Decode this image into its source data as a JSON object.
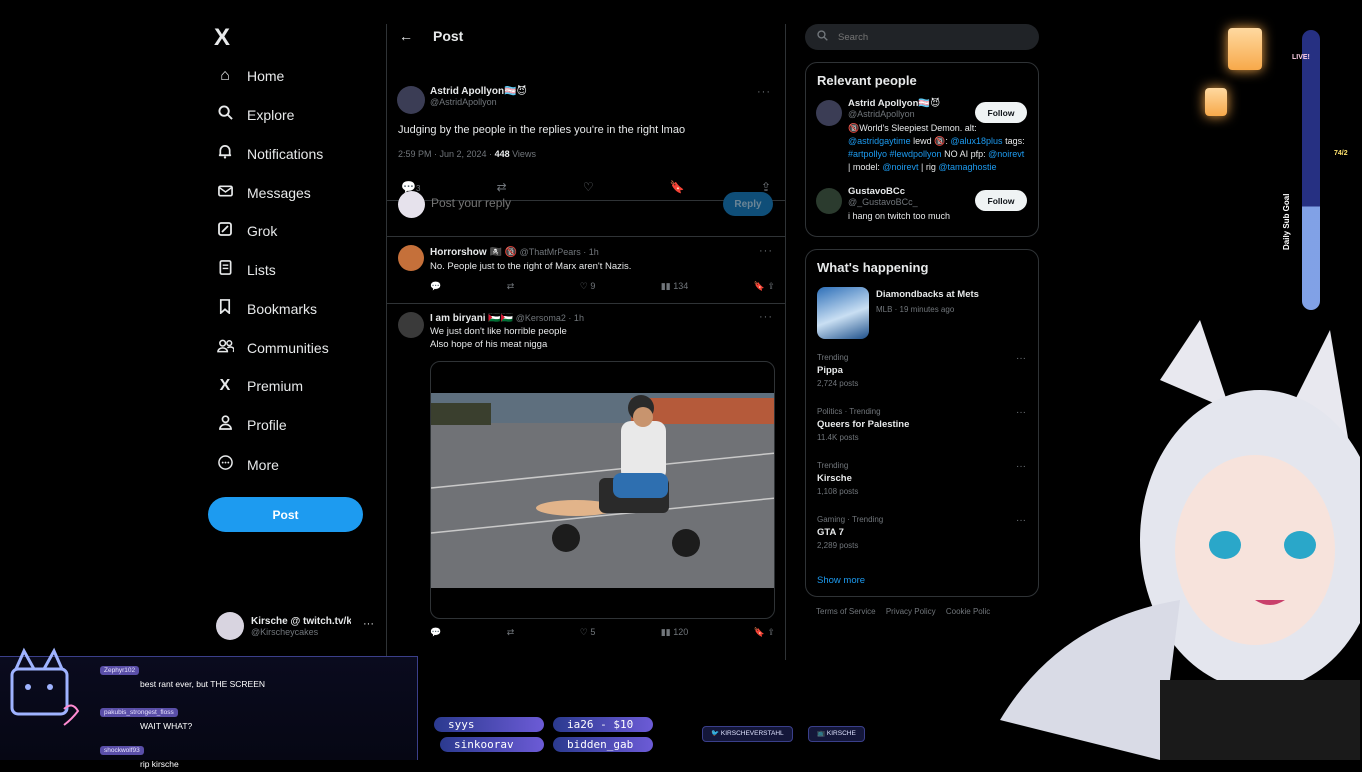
{
  "nav": {
    "logo": "X",
    "items": [
      {
        "label": "Home",
        "icon": "home-icon",
        "glyph": "⌂"
      },
      {
        "label": "Explore",
        "icon": "search-icon",
        "glyph": "⚲"
      },
      {
        "label": "Notifications",
        "icon": "bell-icon",
        "glyph": "🔔"
      },
      {
        "label": "Messages",
        "icon": "envelope-icon",
        "glyph": "✉"
      },
      {
        "label": "Grok",
        "icon": "grok-icon",
        "glyph": "◩"
      },
      {
        "label": "Lists",
        "icon": "list-icon",
        "glyph": "☰"
      },
      {
        "label": "Bookmarks",
        "icon": "bookmark-icon",
        "glyph": "🔖"
      },
      {
        "label": "Communities",
        "icon": "people-icon",
        "glyph": "👥"
      },
      {
        "label": "Premium",
        "icon": "x-icon",
        "glyph": "X"
      },
      {
        "label": "Profile",
        "icon": "person-icon",
        "glyph": "👤"
      },
      {
        "label": "More",
        "icon": "more-circle-icon",
        "glyph": "⋯"
      }
    ],
    "post_button": "Post",
    "account": {
      "name": "Kirsche @ twitch.tv/k",
      "handle": "@Kirscheycakes",
      "more": "···"
    }
  },
  "main": {
    "header": {
      "title": "Post",
      "back": "←"
    },
    "tweet": {
      "name": "Astrid Apollyon🏳️‍⚧️😈",
      "handle": "@AstridApollyon",
      "text": "Judging by the people in the replies you're in the right lmao",
      "time": "2:59 PM · Jun 2, 2024 · ",
      "views_count": "448",
      "views_label": " Views",
      "replies": "3"
    },
    "reply_box": {
      "placeholder": "Post your reply",
      "button": "Reply"
    },
    "replies": [
      {
        "name": "Horrorshow 🏴‍☠️ 🔞",
        "handle": "@ThatMrPears · 1h",
        "text": "No. People just to the right of Marx aren't Nazis.",
        "replies": "",
        "retweets": "",
        "likes": "9",
        "views": "134"
      },
      {
        "name": "I am biryani 🇵🇸🇵🇸",
        "handle": "@Kersoma2 · 1h",
        "text_line1": "We just don't like horrible people",
        "text_line2": "Also hope of his meat nigga",
        "replies": "",
        "retweets": "",
        "likes": "5",
        "views": "120"
      }
    ]
  },
  "right": {
    "search_placeholder": "Search",
    "relevant": {
      "title": "Relevant people",
      "people": [
        {
          "name": "Astrid Apollyon🏳️‍⚧️😈",
          "handle": "@AstridApollyon",
          "bio_a": "🔞World's Sleepiest Demon. alt: ",
          "bio_link1": "@astridgaytime",
          "bio_b": " lewd 🔞: ",
          "bio_link2": "@alux18plus",
          "bio_c": " tags: ",
          "bio_link3": "#artpollyo #lewdpollyon",
          "bio_d": " NO AI pfp: ",
          "bio_link4": "@noirevt",
          "bio_e": " | model: ",
          "bio_link5": "@noirevt",
          "bio_f": " | rig ",
          "bio_link6": "@tamaghostie",
          "follow": "Follow"
        },
        {
          "name": "GustavoBCc",
          "handle": "@_GustavoBCc_",
          "bio": "i hang on twitch too much",
          "follow": "Follow"
        }
      ]
    },
    "happening": {
      "title": "What's happening",
      "featured": {
        "title": "Diamondbacks at Mets",
        "sub": "MLB · 19 minutes ago"
      },
      "trends": [
        {
          "category": "Trending",
          "name": "Pippa",
          "posts": "2,724 posts"
        },
        {
          "category": "Politics · Trending",
          "name": "Queers for Palestine",
          "posts": "11.4K posts"
        },
        {
          "category": "Trending",
          "name": "Kirsche",
          "posts": "1,108 posts"
        },
        {
          "category": "Gaming · Trending",
          "name": "GTA 7",
          "posts": "2,289 posts"
        }
      ],
      "show_more": "Show more"
    },
    "footer": [
      "Terms of Service",
      "Privacy Policy",
      "Cookie Polic"
    ]
  },
  "overlay": {
    "chat": [
      {
        "user": "Zephyr102",
        "msg": "best rant ever, but THE SCREEN"
      },
      {
        "user": "pakubis_strongest_floss",
        "msg": "WAIT WHAT?"
      },
      {
        "user": "shockwolf93",
        "msg": "rip kirsche"
      }
    ],
    "ticker": [
      "syys",
      "ia26 - $10",
      "sinkoorav",
      "bidden_gab"
    ],
    "socials": [
      "KIRSCHEVERSTAHL",
      "KIRSCHE"
    ],
    "live": "LIVE!",
    "goal_label": "Daily Sub Goal",
    "goal_count": "74/2",
    "goal_progress": 0.37
  }
}
